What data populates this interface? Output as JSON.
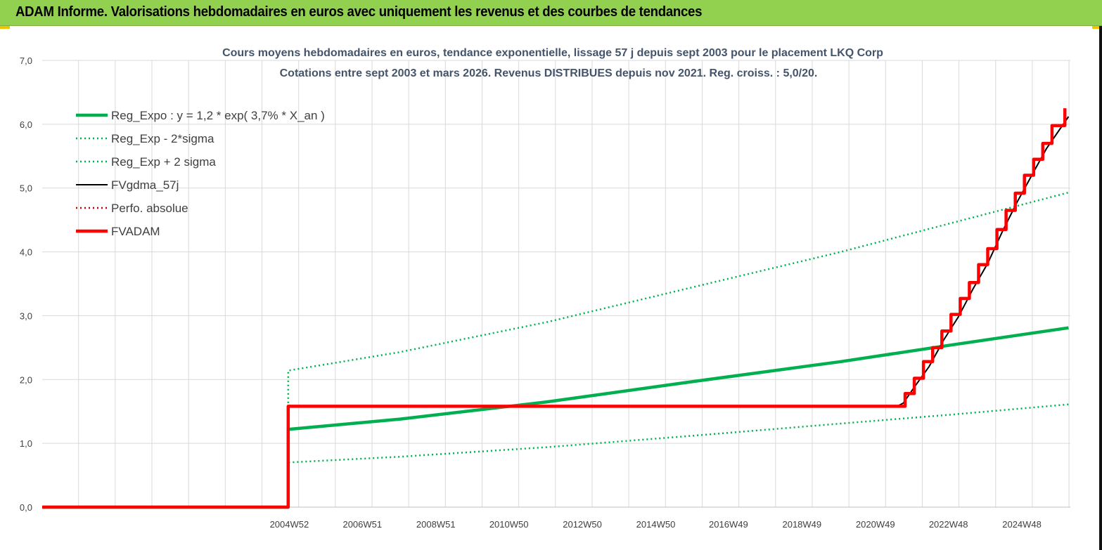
{
  "header": {
    "title": "ADAM Informe. Valorisations hebdomadaires en euros avec uniquement les revenus et des courbes de tendances"
  },
  "colors": {
    "header_bg": "#92d050",
    "green": "#00b050",
    "black": "#000000",
    "red": "#ff0000",
    "grid": "#d9d9d9"
  },
  "chart_data": {
    "type": "line",
    "title_line1": "Cours moyens hebdomadaires en euros, tendance exponentielle, lissage 57 j depuis sept 2003 pour le placement LKQ Corp",
    "title_line2": "Cotations entre sept 2003 et mars 2026. Revenus DISTRIBUES depuis nov 2021. Reg. croiss. : 5,0/20.",
    "x_tick_labels": [
      "2004W52",
      "2006W51",
      "2008W51",
      "2010W50",
      "2012W50",
      "2014W50",
      "2016W49",
      "2018W49",
      "2020W49",
      "2022W48",
      "2024W48"
    ],
    "x_tick_years": [
      2004.98,
      2006.97,
      2008.97,
      2010.96,
      2012.96,
      2014.96,
      2016.94,
      2018.94,
      2020.94,
      2022.93,
      2024.93
    ],
    "xlim": [
      1998.25,
      2026.25
    ],
    "ylim": [
      0,
      7
    ],
    "y_ticks": [
      "0,0",
      "1,0",
      "2,0",
      "3,0",
      "4,0",
      "5,0",
      "6,0",
      "7,0"
    ],
    "legend_position": "top-left",
    "series": [
      {
        "name": "Reg_Expo : y = 1,2 * exp( 3,7% *  X_an )",
        "color": "#00b050",
        "style": "solid-thick",
        "points": [
          [
            1998.25,
            0
          ],
          [
            2004.95,
            0
          ],
          [
            2004.95,
            1.22
          ],
          [
            2008,
            1.38
          ],
          [
            2012,
            1.65
          ],
          [
            2016,
            1.97
          ],
          [
            2020,
            2.28
          ],
          [
            2023,
            2.54
          ],
          [
            2026.2,
            2.81
          ]
        ]
      },
      {
        "name": "Reg_Exp - 2*sigma",
        "color": "#00b050",
        "style": "dotted",
        "points": [
          [
            1998.25,
            0
          ],
          [
            2004.95,
            0
          ],
          [
            2004.95,
            0.7
          ],
          [
            2008,
            0.79
          ],
          [
            2012,
            0.94
          ],
          [
            2016,
            1.12
          ],
          [
            2020,
            1.31
          ],
          [
            2023,
            1.45
          ],
          [
            2026.2,
            1.61
          ]
        ]
      },
      {
        "name": "Reg_Exp + 2 sigma",
        "color": "#00b050",
        "style": "dotted",
        "points": [
          [
            1998.25,
            0
          ],
          [
            2004.95,
            0
          ],
          [
            2004.95,
            2.14
          ],
          [
            2008,
            2.43
          ],
          [
            2012,
            2.9
          ],
          [
            2016,
            3.45
          ],
          [
            2020,
            4.0
          ],
          [
            2023,
            4.45
          ],
          [
            2026.2,
            4.93
          ]
        ]
      },
      {
        "name": "FVgdma_57j",
        "color": "#000000",
        "style": "solid",
        "points": [
          [
            1998.25,
            0
          ],
          [
            2004.95,
            0
          ],
          [
            2004.95,
            1.57
          ],
          [
            2021.5,
            1.57
          ],
          [
            2021.7,
            1.63
          ],
          [
            2022.0,
            1.88
          ],
          [
            2022.4,
            2.2
          ],
          [
            2022.8,
            2.62
          ],
          [
            2023.2,
            2.98
          ],
          [
            2023.6,
            3.42
          ],
          [
            2024.0,
            3.82
          ],
          [
            2024.4,
            4.32
          ],
          [
            2024.8,
            4.78
          ],
          [
            2025.2,
            5.2
          ],
          [
            2025.6,
            5.62
          ],
          [
            2026.2,
            6.12
          ]
        ]
      },
      {
        "name": "Perfo. absolue",
        "color": "#c00000",
        "style": "dotted",
        "points": []
      },
      {
        "name": "FVADAM",
        "color": "#ff0000",
        "style": "solid-thick",
        "points": [
          [
            1998.25,
            0
          ],
          [
            2004.95,
            0
          ],
          [
            2004.95,
            1.58
          ],
          [
            2021.5,
            1.58
          ],
          [
            2021.75,
            1.58
          ],
          [
            2021.75,
            1.78
          ],
          [
            2022.0,
            1.78
          ],
          [
            2022.0,
            2.02
          ],
          [
            2022.25,
            2.02
          ],
          [
            2022.25,
            2.28
          ],
          [
            2022.5,
            2.28
          ],
          [
            2022.5,
            2.5
          ],
          [
            2022.75,
            2.5
          ],
          [
            2022.75,
            2.76
          ],
          [
            2023.0,
            2.76
          ],
          [
            2023.0,
            3.02
          ],
          [
            2023.25,
            3.02
          ],
          [
            2023.25,
            3.27
          ],
          [
            2023.5,
            3.27
          ],
          [
            2023.5,
            3.52
          ],
          [
            2023.75,
            3.52
          ],
          [
            2023.75,
            3.8
          ],
          [
            2024.0,
            3.8
          ],
          [
            2024.0,
            4.05
          ],
          [
            2024.25,
            4.05
          ],
          [
            2024.25,
            4.35
          ],
          [
            2024.5,
            4.35
          ],
          [
            2024.5,
            4.65
          ],
          [
            2024.75,
            4.65
          ],
          [
            2024.75,
            4.92
          ],
          [
            2025.0,
            4.92
          ],
          [
            2025.0,
            5.2
          ],
          [
            2025.25,
            5.2
          ],
          [
            2025.25,
            5.45
          ],
          [
            2025.5,
            5.45
          ],
          [
            2025.5,
            5.7
          ],
          [
            2025.75,
            5.7
          ],
          [
            2025.75,
            5.98
          ],
          [
            2026.1,
            5.98
          ],
          [
            2026.1,
            6.25
          ]
        ]
      }
    ]
  }
}
